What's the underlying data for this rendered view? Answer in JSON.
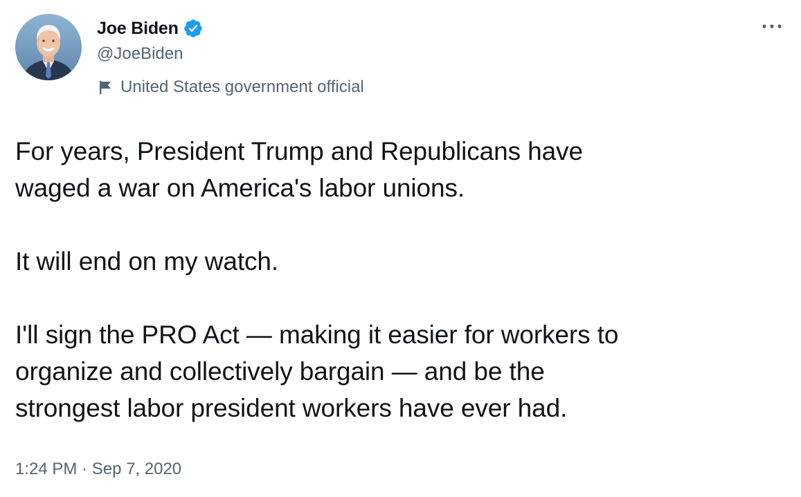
{
  "author": {
    "name": "Joe Biden",
    "handle": "@JoeBiden",
    "verified": true,
    "label": "United States government official"
  },
  "tweet": {
    "text": "For years, President Trump and Republicans have\nwaged a war on America's labor unions.\n\nIt will end on my watch.\n\nI'll sign the PRO Act — making it easier for workers to\norganize and collectively bargain — and be the\nstrongest labor president workers have ever had.",
    "timestamp": "1:24 PM · Sep 7, 2020"
  },
  "icons": {
    "verified": "verified-badge-icon",
    "label": "flag-icon",
    "more": "more-options-icon"
  },
  "colors": {
    "verified_blue": "#1d9bf0",
    "secondary_text": "#536471",
    "primary_text": "#0f1419"
  }
}
